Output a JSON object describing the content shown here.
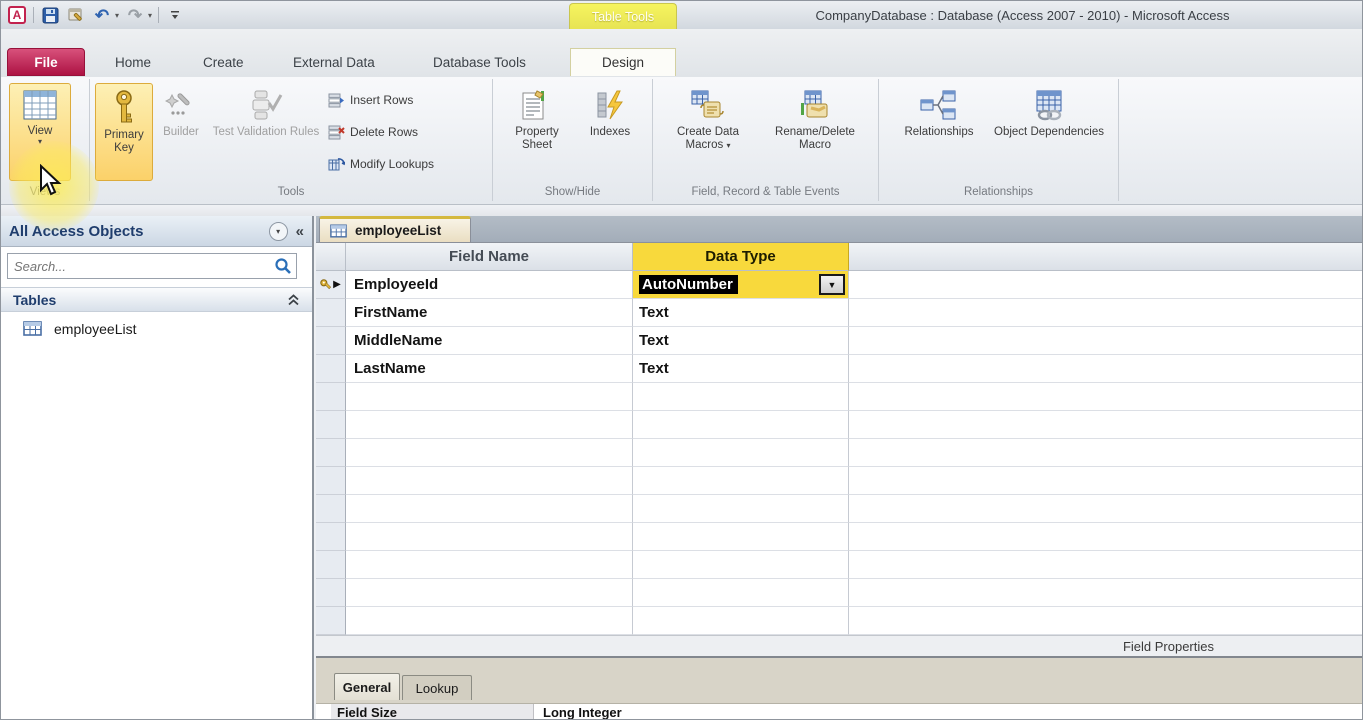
{
  "window": {
    "title": "CompanyDatabase : Database (Access 2007 - 2010)  -  Microsoft Access",
    "contextual_tab_group": "Table Tools"
  },
  "icons": {
    "chevron_down": "▾",
    "dropdown_arrow": "▼",
    "collapse_left": "«",
    "row_indicator": "▶",
    "undo": "↶",
    "redo": "↷",
    "access_logo_letter": "A"
  },
  "ribbon_tabs": [
    {
      "label": "File"
    },
    {
      "label": "Home"
    },
    {
      "label": "Create"
    },
    {
      "label": "External Data"
    },
    {
      "label": "Database Tools"
    },
    {
      "label": "Design"
    }
  ],
  "ribbon": {
    "groups": [
      {
        "label": "Views"
      },
      {
        "label": "Tools"
      },
      {
        "label": "Show/Hide"
      },
      {
        "label": "Field, Record & Table Events"
      },
      {
        "label": "Relationships"
      }
    ],
    "buttons": {
      "view": "View",
      "primary_key": "Primary Key",
      "builder": "Builder",
      "test_validation_rules": "Test Validation Rules",
      "insert_rows": "Insert Rows",
      "delete_rows": "Delete Rows",
      "modify_lookups": "Modify Lookups",
      "property_sheet": "Property Sheet",
      "indexes": "Indexes",
      "create_data_macros": "Create Data Macros",
      "rename_delete_macro": "Rename/Delete Macro",
      "relationships": "Relationships",
      "object_dependencies": "Object Dependencies"
    }
  },
  "nav_pane": {
    "title": "All Access Objects",
    "search_placeholder": "Search...",
    "group_label": "Tables",
    "items": [
      {
        "label": "employeeList"
      }
    ]
  },
  "document": {
    "tab_label": "employeeList",
    "grid": {
      "columns": [
        "Field Name",
        "Data Type"
      ],
      "fields": [
        {
          "name": "EmployeeId",
          "type": "AutoNumber"
        },
        {
          "name": "FirstName",
          "type": "Text"
        },
        {
          "name": "MiddleName",
          "type": "Text"
        },
        {
          "name": "LastName",
          "type": "Text"
        }
      ]
    },
    "field_properties_label": "Field Properties",
    "property_tabs": [
      {
        "label": "General"
      },
      {
        "label": "Lookup"
      }
    ],
    "properties": [
      {
        "label": "Field Size",
        "value": "Long Integer"
      }
    ]
  },
  "colors": {
    "file_tab": "#b91a4d",
    "table_tools_tab": "#e9e45a",
    "selection_yellow": "#f8d93c",
    "ribbon_highlight": "#fbd46b"
  }
}
